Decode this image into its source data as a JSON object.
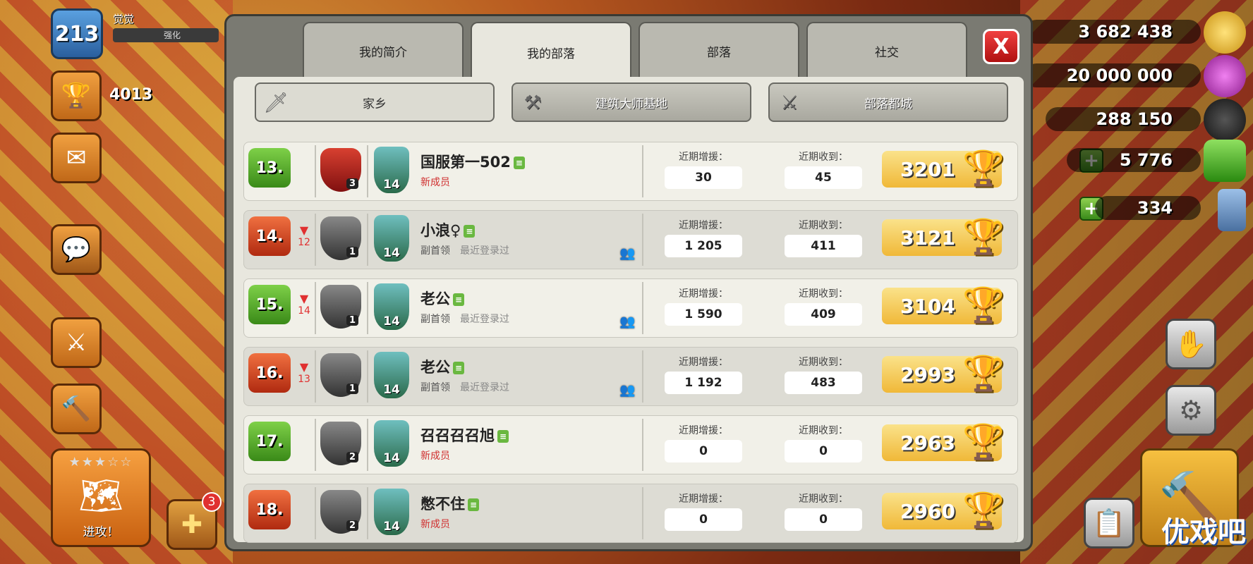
{
  "player": {
    "level": "213",
    "name": "觉觉",
    "xp_label": "强化",
    "trophies": "4013"
  },
  "left_hud": {
    "attack_label": "进攻！",
    "notif_count": "3"
  },
  "resources": {
    "gold": "3 682 438",
    "elixir": "20 000 000",
    "dark_elixir": "288 150",
    "gems": "5 776",
    "builder": "334"
  },
  "tabs": [
    {
      "label": "我的简介",
      "active": false
    },
    {
      "label": "我的部落",
      "active": true
    },
    {
      "label": "部落",
      "active": false
    },
    {
      "label": "社交",
      "active": false
    }
  ],
  "close_label": "X",
  "subtabs": [
    {
      "label": "家乡",
      "icon": "sword-icon",
      "active": true
    },
    {
      "label": "建筑大师基地",
      "icon": "crossed-axes-icon",
      "active": false
    },
    {
      "label": "部落都城",
      "icon": "crossed-swords-icon",
      "active": false
    }
  ],
  "stat_labels": {
    "donated": "近期增援：",
    "received": "近期收到："
  },
  "members": [
    {
      "rank": "13.",
      "rank_color": "green",
      "change": "",
      "league": "red",
      "league_level": "3",
      "th_level": "14",
      "name": "国服第一502",
      "role": "新成员",
      "role_type": "new",
      "last_seen": "",
      "friend": false,
      "donated": "30",
      "received": "45",
      "trophies": "3201"
    },
    {
      "rank": "14.",
      "rank_color": "red",
      "change": "12",
      "league": "grey",
      "league_level": "1",
      "th_level": "14",
      "name": "小浪♀",
      "role": "副首领",
      "role_type": "sub",
      "last_seen": "最近登录过",
      "friend": true,
      "donated": "1 205",
      "received": "411",
      "trophies": "3121"
    },
    {
      "rank": "15.",
      "rank_color": "green",
      "change": "14",
      "league": "grey",
      "league_level": "1",
      "th_level": "14",
      "name": "老公",
      "role": "副首领",
      "role_type": "sub",
      "last_seen": "最近登录过",
      "friend": true,
      "donated": "1 590",
      "received": "409",
      "trophies": "3104"
    },
    {
      "rank": "16.",
      "rank_color": "red",
      "change": "13",
      "league": "grey",
      "league_level": "1",
      "th_level": "14",
      "name": "老公",
      "role": "副首领",
      "role_type": "sub",
      "last_seen": "最近登录过",
      "friend": true,
      "donated": "1 192",
      "received": "483",
      "trophies": "2993"
    },
    {
      "rank": "17.",
      "rank_color": "green",
      "change": "",
      "league": "grey",
      "league_level": "2",
      "th_level": "14",
      "name": "召召召召旭",
      "role": "新成员",
      "role_type": "new",
      "last_seen": "",
      "friend": false,
      "donated": "0",
      "received": "0",
      "trophies": "2963"
    },
    {
      "rank": "18.",
      "rank_color": "red",
      "change": "",
      "league": "grey",
      "league_level": "2",
      "th_level": "14",
      "name": "憋不住",
      "role": "新成员",
      "role_type": "new",
      "last_seen": "",
      "friend": false,
      "donated": "0",
      "received": "0",
      "trophies": "2960"
    }
  ],
  "watermark": "优戏吧"
}
